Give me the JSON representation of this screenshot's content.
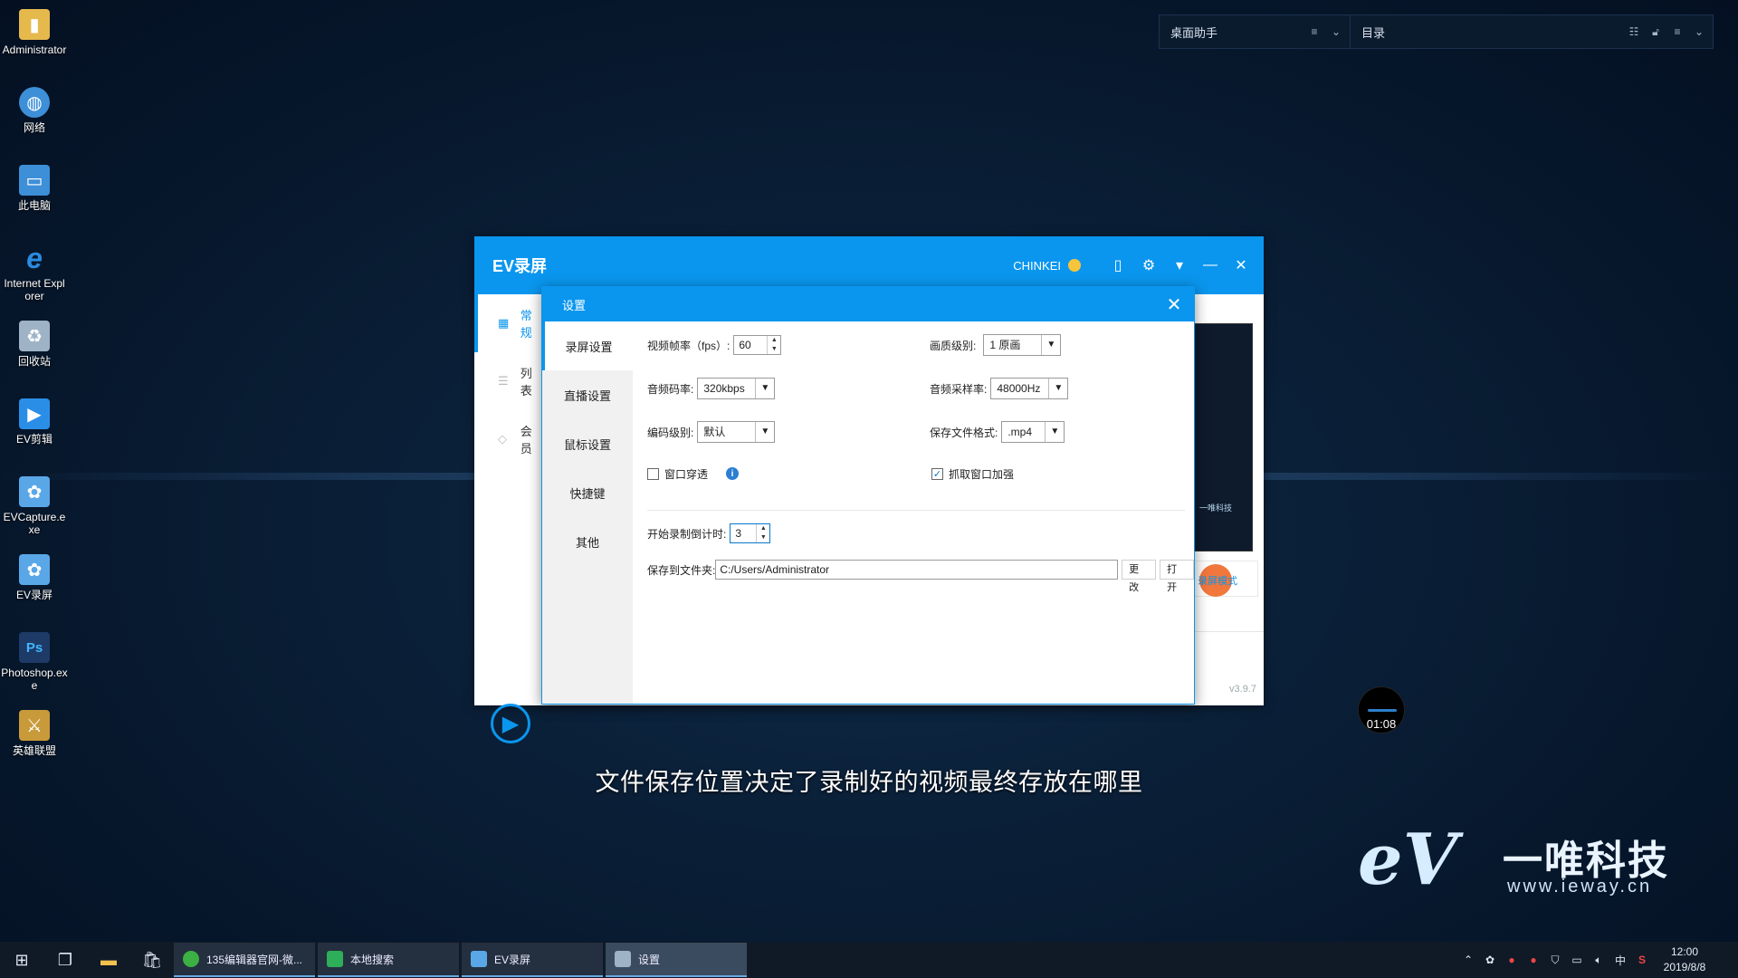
{
  "desktop": {
    "icons": [
      {
        "label": "Administrator",
        "icon": "user-folder-icon",
        "color": "#e6b94d"
      },
      {
        "label": "网络",
        "icon": "network-icon",
        "color": "#3d8fd8"
      },
      {
        "label": "此电脑",
        "icon": "computer-icon",
        "color": "#3d8fd8"
      },
      {
        "label": "Internet Explorer",
        "icon": "ie-icon",
        "color": "#2a8be0"
      },
      {
        "label": "回收站",
        "icon": "recycle-bin-icon",
        "color": "#9fb3c6"
      },
      {
        "label": "EV剪辑",
        "icon": "ev-editor-icon",
        "color": "#2b8ee6"
      },
      {
        "label": "EVCapture.exe",
        "icon": "ev-capture-icon",
        "color": "#5aa7e8"
      },
      {
        "label": "EV录屏",
        "icon": "ev-recorder-icon",
        "color": "#5aa7e8"
      },
      {
        "label": "Photoshop.exe",
        "icon": "photoshop-icon",
        "color": "#1e3a66"
      },
      {
        "label": "英雄联盟",
        "icon": "lol-icon",
        "color": "#c99a3a"
      }
    ]
  },
  "topbars": {
    "assistant": {
      "title": "桌面助手"
    },
    "catalog": {
      "title": "目录"
    }
  },
  "ev_window": {
    "title": "EV录屏",
    "user": "CHINKEI",
    "sidebar": [
      {
        "label": "常规"
      },
      {
        "label": "列表"
      },
      {
        "label": "会员"
      }
    ],
    "preview_brand": "一唯科技",
    "record_button": "录屏模式",
    "version": "v3.9.7"
  },
  "settings_dialog": {
    "title": "设置",
    "nav": [
      {
        "label": "录屏设置"
      },
      {
        "label": "直播设置"
      },
      {
        "label": "鼠标设置"
      },
      {
        "label": "快捷键"
      },
      {
        "label": "其他"
      }
    ],
    "fps_label": "视频帧率（fps）:",
    "fps_value": "60",
    "quality_label": "画质级别:",
    "quality_value": "1 原画",
    "audio_bitrate_label": "音频码率:",
    "audio_bitrate_value": "320kbps",
    "sample_rate_label": "音频采样率:",
    "sample_rate_value": "48000Hz",
    "encode_label": "编码级别:",
    "encode_value": "默认",
    "format_label": "保存文件格式:",
    "format_value": ".mp4",
    "window_through_label": "窗口穿透",
    "window_through_checked": false,
    "capture_enhance_label": "抓取窗口加强",
    "capture_enhance_checked": true,
    "countdown_label": "开始录制倒计时:",
    "countdown_value": "3",
    "save_folder_label": "保存到文件夹:",
    "save_folder_value": "C:/Users/Administrator",
    "change_button": "更改",
    "open_button": "打开"
  },
  "timer": "01:08",
  "subtitle": "文件保存位置决定了录制好的视频最终存放在哪里",
  "logo": {
    "mark": "eV",
    "name": "一唯科技",
    "url": "www.ieway.cn"
  },
  "taskbar": {
    "apps": [
      {
        "label": "135编辑器官网-微...",
        "color": "#3cb043"
      },
      {
        "label": "本地搜索",
        "color": "#2fae5a"
      },
      {
        "label": "EV录屏",
        "color": "#5aa7e8"
      },
      {
        "label": "设置",
        "color": "#9fb3c6"
      }
    ],
    "ime": "中",
    "time": "12:00",
    "date": "2019/8/8"
  }
}
